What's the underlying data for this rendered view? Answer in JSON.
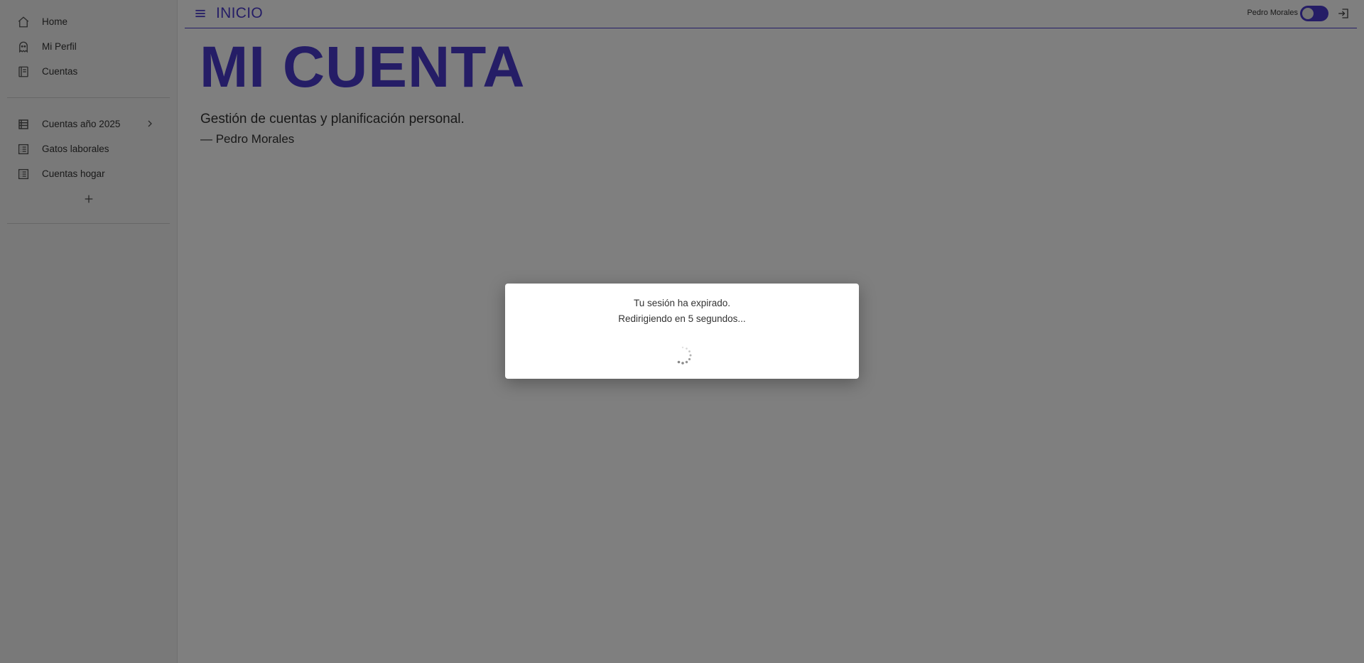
{
  "sidebar": {
    "items": [
      {
        "label": "Home",
        "icon": "home-icon"
      },
      {
        "label": "Mi Perfil",
        "icon": "ghost-icon"
      },
      {
        "label": "Cuentas",
        "icon": "notebook-icon"
      }
    ],
    "books": [
      {
        "label": "Cuentas año 2025",
        "icon": "list-icon",
        "expandable": true
      },
      {
        "label": "Gatos laborales",
        "icon": "list-icon"
      },
      {
        "label": "Cuentas hogar",
        "icon": "list-icon"
      }
    ],
    "add_icon": "plus-icon"
  },
  "header": {
    "title": "INICIO",
    "user_name": "Pedro Morales",
    "theme_toggle_on": true,
    "accent_color": "#4a3bcd"
  },
  "main": {
    "title": "MI CUENTA",
    "quote": "Gestión de cuentas y planificación personal.",
    "author": "— Pedro Morales"
  },
  "dialog": {
    "line1": "Tu sesión ha expirado.",
    "line2": "Redirigiendo en 5 segundos..."
  }
}
